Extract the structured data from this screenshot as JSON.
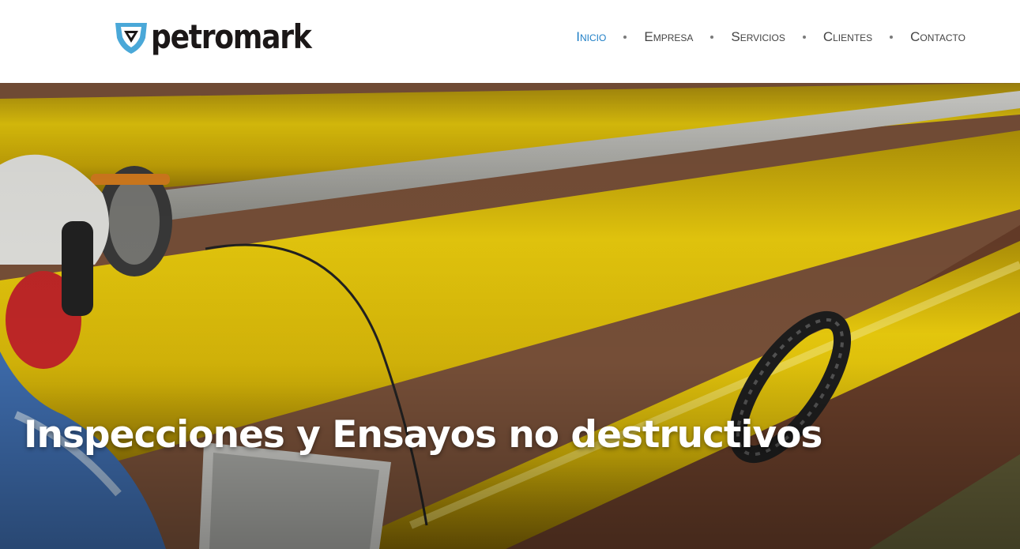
{
  "brand": {
    "name": "petromark",
    "icon": "shield-logo-icon",
    "colors": {
      "shield": "#4aa8d8",
      "text": "#1b1717"
    }
  },
  "nav": {
    "items": [
      {
        "label": "Inicio",
        "active": true
      },
      {
        "label": "Empresa",
        "active": false
      },
      {
        "label": "Servicios",
        "active": false
      },
      {
        "label": "Clientes",
        "active": false
      },
      {
        "label": "Contacto",
        "active": false
      }
    ],
    "colors": {
      "active": "#1f7fc6",
      "default": "#444444"
    }
  },
  "hero": {
    "title": "Inspecciones y Ensayos no destructivos",
    "image": "yellow-pipelines-inspection-photo"
  }
}
